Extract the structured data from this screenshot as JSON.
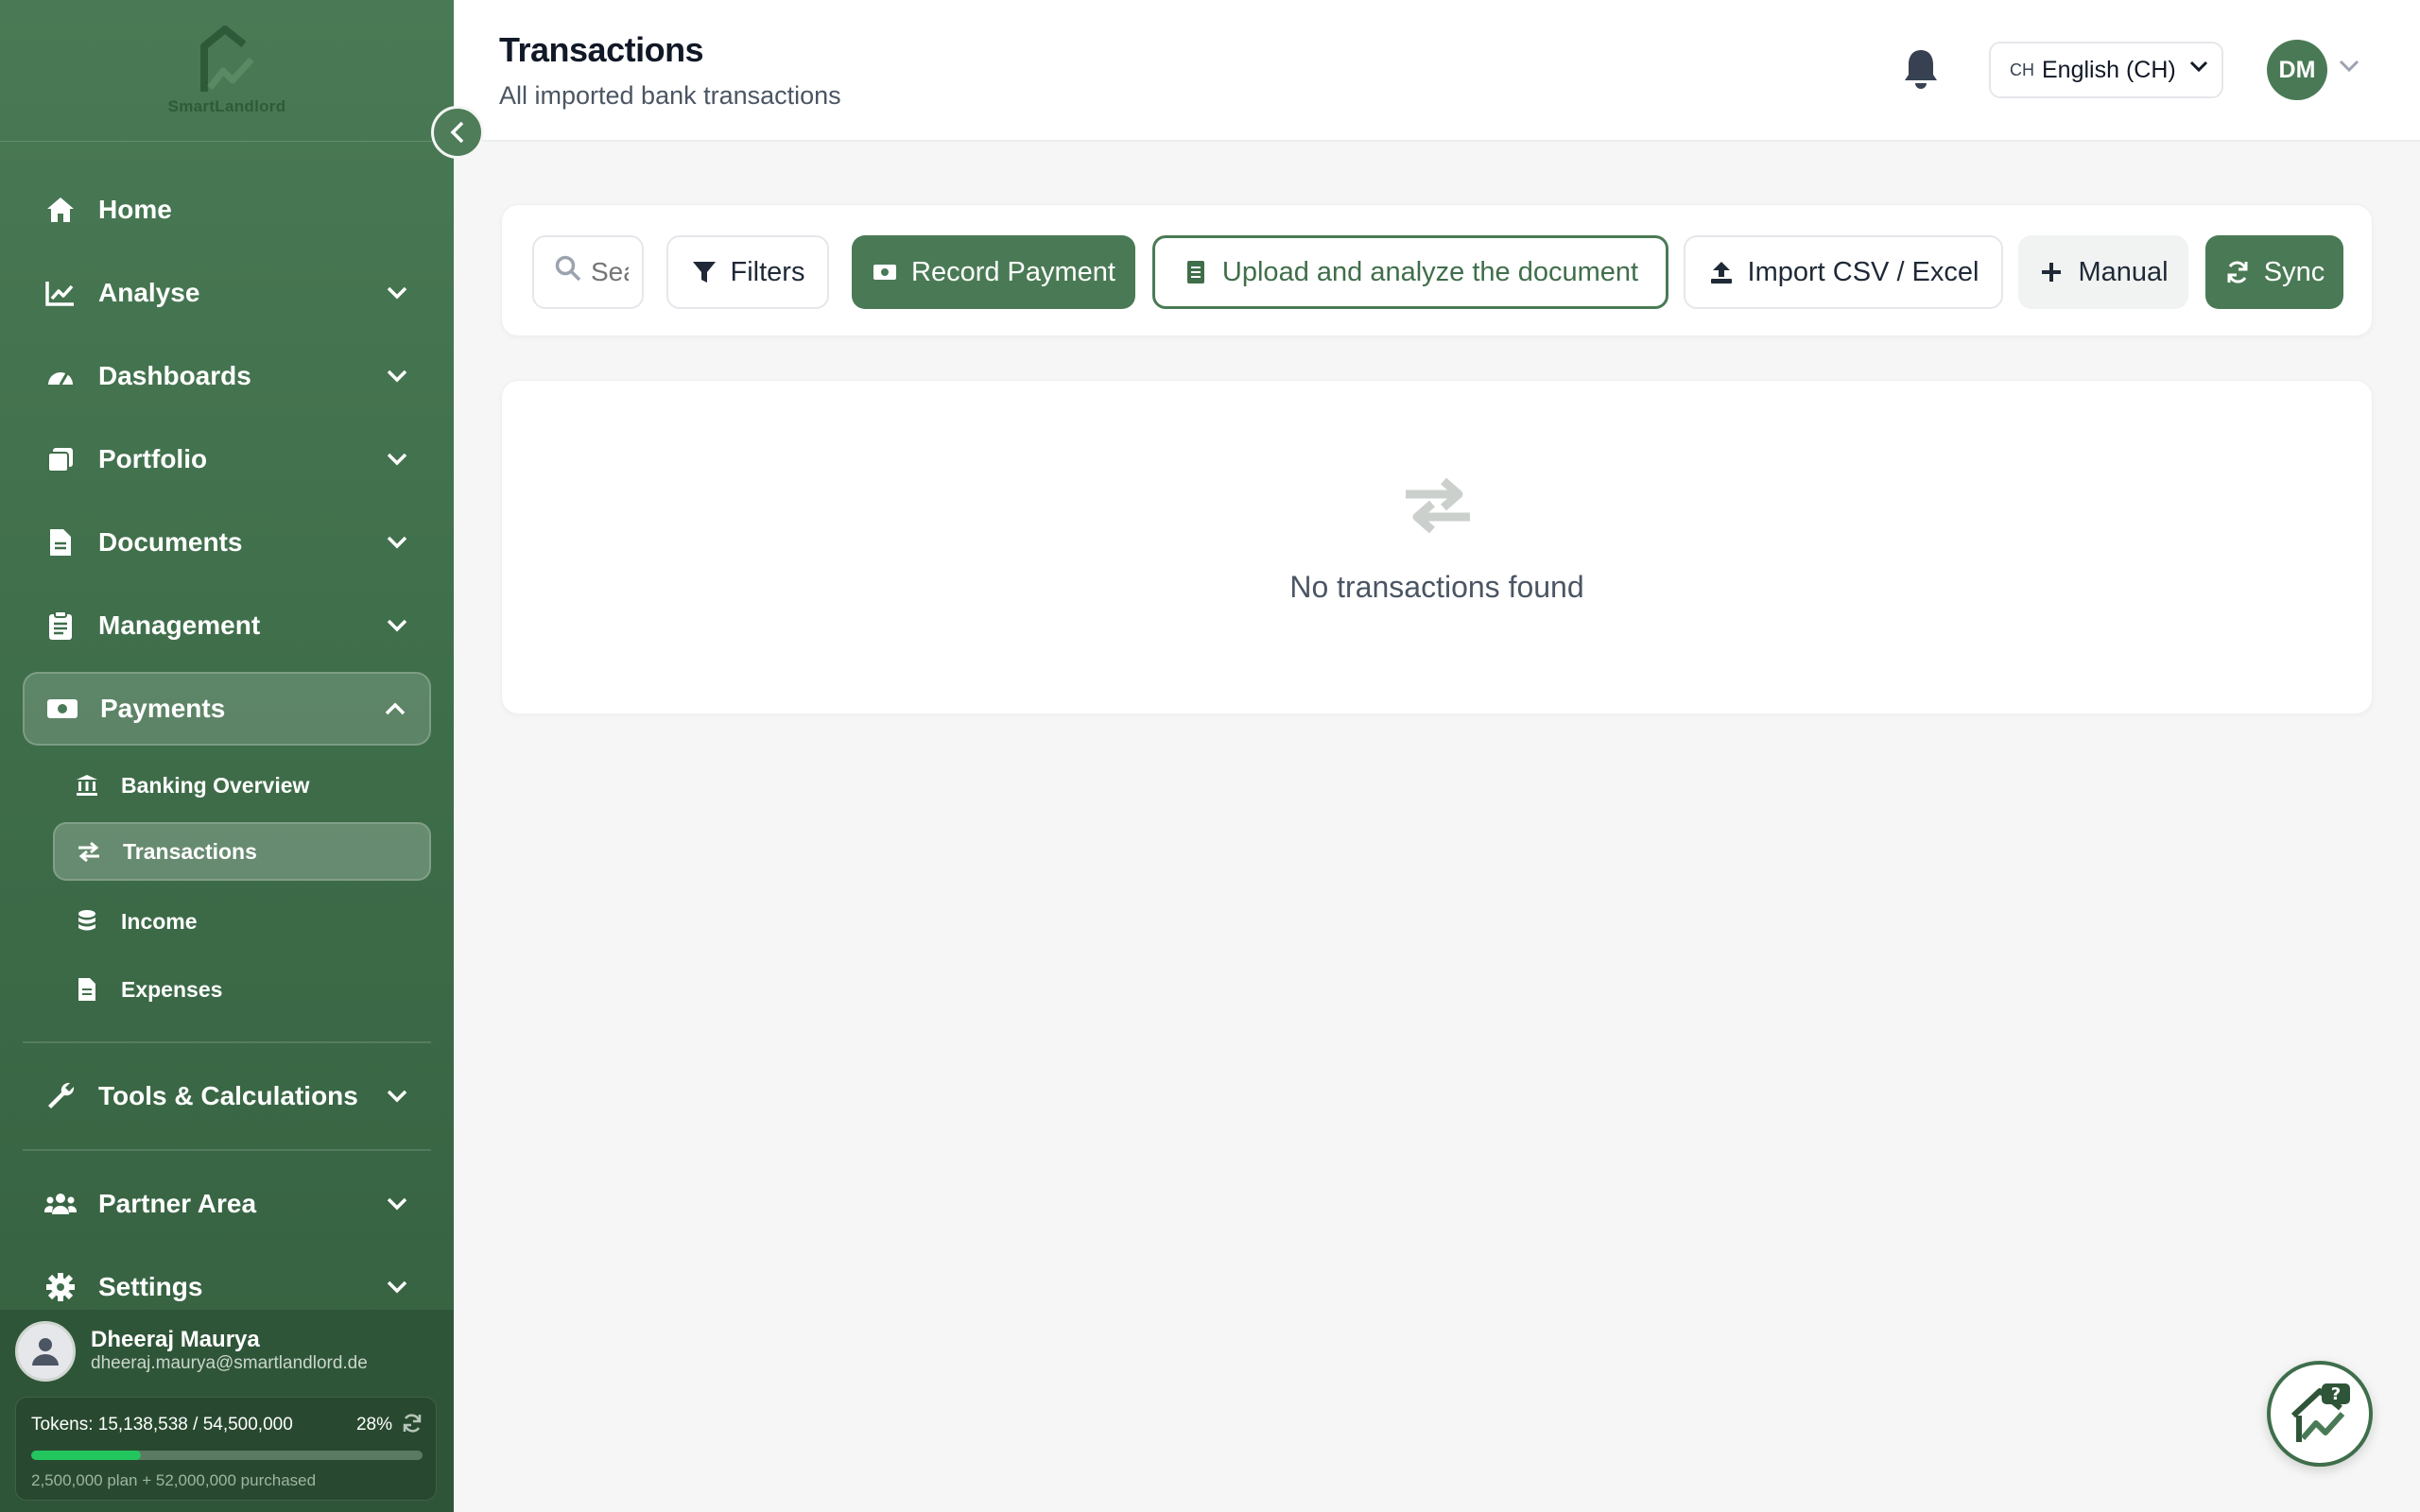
{
  "app": {
    "logo_text": "SmartLandlord"
  },
  "header": {
    "title": "Transactions",
    "subtitle": "All imported bank transactions",
    "language": {
      "code": "CH",
      "label": "English (CH)"
    },
    "user_initials": "DM"
  },
  "sidebar": {
    "items": [
      {
        "label": "Home",
        "icon": "home-icon"
      },
      {
        "label": "Analyse",
        "icon": "chart-line-icon"
      },
      {
        "label": "Dashboards",
        "icon": "gauge-icon"
      },
      {
        "label": "Portfolio",
        "icon": "copy-icon"
      },
      {
        "label": "Documents",
        "icon": "file-icon"
      },
      {
        "label": "Management",
        "icon": "clipboard-icon"
      },
      {
        "label": "Payments",
        "icon": "money-bill-icon"
      },
      {
        "label": "Tools & Calculations",
        "icon": "wrench-icon"
      },
      {
        "label": "Partner Area",
        "icon": "users-icon"
      },
      {
        "label": "Settings",
        "icon": "gear-icon"
      }
    ],
    "payments_sub": [
      {
        "label": "Banking Overview",
        "icon": "bank-icon"
      },
      {
        "label": "Transactions",
        "icon": "exchange-icon"
      },
      {
        "label": "Income",
        "icon": "coins-icon"
      },
      {
        "label": "Expenses",
        "icon": "file-invoice-icon"
      }
    ],
    "user": {
      "name": "Dheeraj Maurya",
      "email": "dheeraj.maurya@smartlandlord.de"
    },
    "tokens": {
      "text": "Tokens: 15,138,538 / 54,500,000",
      "percent_label": "28%",
      "percent": 28,
      "sub": "2,500,000 plan + 52,000,000 purchased"
    }
  },
  "toolbar": {
    "search_placeholder": "Search",
    "filters_label": "Filters",
    "record_label": "Record Payment",
    "upload_label": "Upload and analyze the document",
    "import_label": "Import CSV / Excel",
    "manual_label": "Manual",
    "sync_label": "Sync"
  },
  "empty_state": {
    "text": "No transactions found"
  },
  "colors": {
    "brand": "#4a7a55",
    "brand_dark": "#2f5538",
    "progress": "#22c55e"
  }
}
